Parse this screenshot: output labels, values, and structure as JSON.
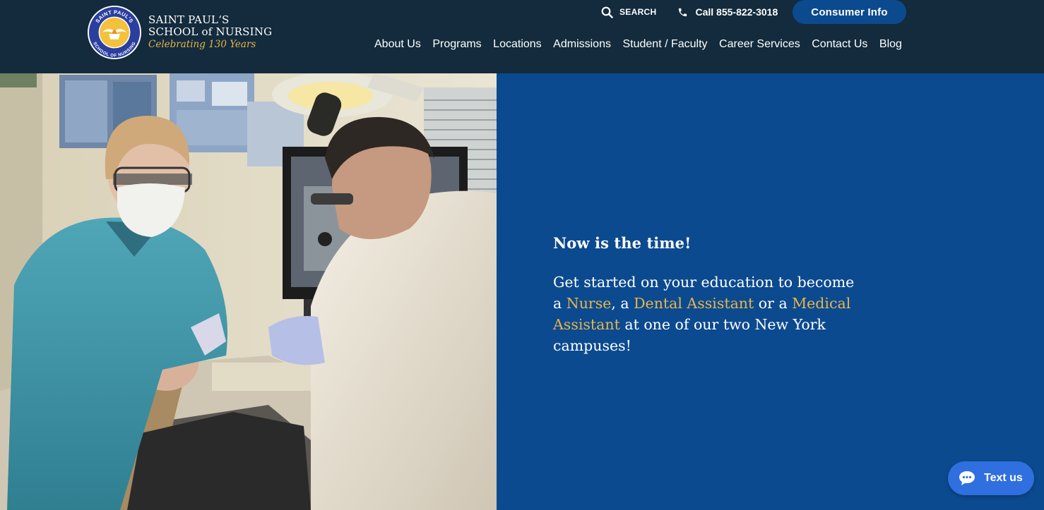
{
  "brand": {
    "seal_text_top": "SAINT PAUL'S",
    "seal_text_bottom": "SCHOOL OF NURSING",
    "name_line1": "SAINT PAUL‘S",
    "name_line2": "SCHOOL of NURSING",
    "tagline": "Celebrating 130 Years",
    "accent_color": "#e7b54c",
    "header_color": "#132b3c"
  },
  "utility": {
    "search_label": "SEARCH",
    "search_icon": "magnifier-icon",
    "phone_label": "Call 855-822-3018",
    "phone_icon": "phone-icon",
    "consumer_info_label": "Consumer Info"
  },
  "nav": {
    "items": [
      "About Us",
      "Programs",
      "Locations",
      "Admissions",
      "Student / Faculty",
      "Career Services",
      "Contact Us",
      "Blog"
    ]
  },
  "hero": {
    "panel_color": "#0c4a8f",
    "heading": "Now is the time!",
    "text": {
      "part1": "Get started on your education to become a ",
      "nurse": "Nurse",
      "part2": ", a ",
      "dental": "Dental Assistant",
      "part3": " or a ",
      "medical": "Medical Assistant",
      "part4": " at one of our two New York campuses!"
    }
  },
  "chat": {
    "label": "Text us",
    "icon": "chat-bubble-icon",
    "color": "#2f6fe0"
  }
}
